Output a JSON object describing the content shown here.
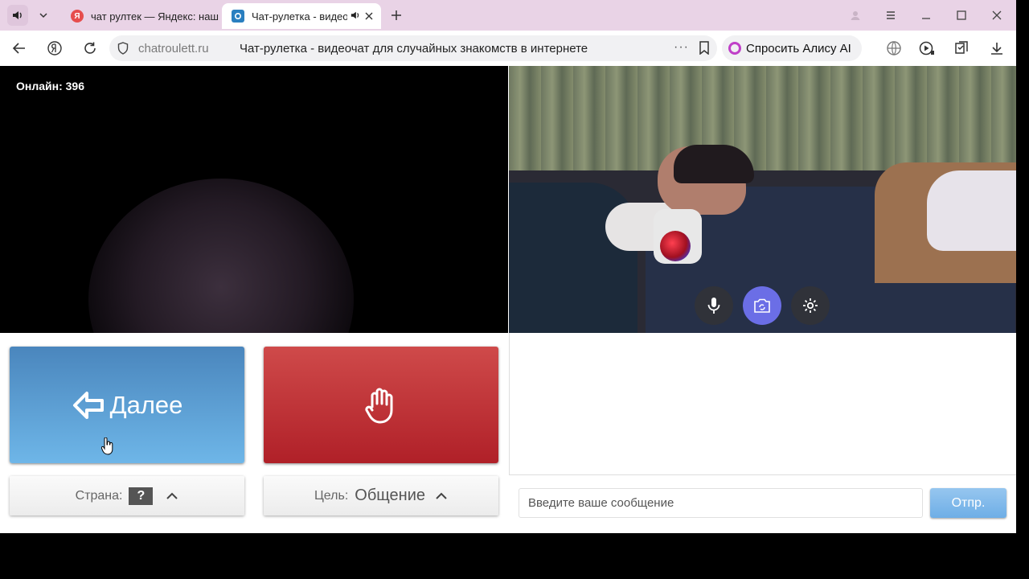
{
  "browser": {
    "tabs": [
      {
        "title": "чат рултек — Яндекс: наш",
        "favicon": "yandex-icon",
        "active": false
      },
      {
        "title": "Чат-рулетка - видеоч",
        "favicon": "chatroulette-icon",
        "active": true,
        "audio": true
      }
    ],
    "address": {
      "domain": "chatroulett.ru",
      "page_title": "Чат-рулетка - видеочат для случайных знакомств в интернете"
    },
    "alice_label": "Спросить Алису AI"
  },
  "video": {
    "online_label": "Онлайн: 396"
  },
  "controls": {
    "next_label": "Далее",
    "country_label": "Страна:",
    "country_value": "?",
    "goal_label": "Цель:",
    "goal_value": "Общение"
  },
  "chat": {
    "input_placeholder": "Введите ваше сообщение",
    "send_label": "Отпр."
  },
  "colors": {
    "tab_strip": "#e9d3e6",
    "next_button": "#5a9fd4",
    "stop_button": "#c0303a",
    "camera_toggle_active": "#6b6ee6"
  }
}
